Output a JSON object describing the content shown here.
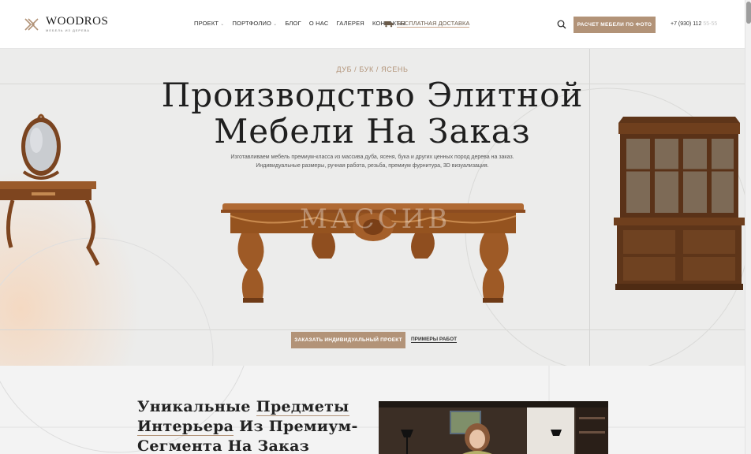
{
  "header": {
    "logo_name": "WOODROS",
    "logo_tagline": "МЕБЕЛЬ ИЗ ДЕРЕВА",
    "nav": [
      {
        "label": "ПРОЕКТ",
        "has_caret": true
      },
      {
        "label": "ПОРТФОЛИО",
        "has_caret": true
      },
      {
        "label": "БЛОГ",
        "has_caret": false
      },
      {
        "label": "О НАС",
        "has_caret": false
      },
      {
        "label": "ГАЛЕРЕЯ",
        "has_caret": false
      },
      {
        "label": "КОНТАКТЫ",
        "has_caret": false
      }
    ],
    "delivery_label": "БЕСПЛАТНАЯ ДОСТАВКА",
    "delivery_icon": "truck-icon",
    "search_icon": "search-icon",
    "cta_label": "РАСЧЕТ МЕБЕЛИ ПО ФОТО",
    "phone_visible": "+7 (930) 112",
    "phone_faded": "55-55"
  },
  "hero": {
    "woods": "ДУБ / БУК / ЯСЕНЬ",
    "title_line1": "Производство Элитной",
    "title_line2": "Мебели На Заказ",
    "subtitle_line1": "Изготавливаем мебель премиум-класса из массива дуба, ясеня, бука и других ценных пород дерева на заказ.",
    "subtitle_line2": "Индивидуальные размеры, ручная работа, резьба, премиум фурнитура, 3D визуализация.",
    "watermark": "МАССИВ",
    "primary_button": "ЗАКАЗАТЬ ИНДИВИДУАЛЬНЫЙ ПРОЕКТ",
    "secondary_link": "ПРИМЕРЫ РАБОТ"
  },
  "lower": {
    "title_line1_a": "Уникальные",
    "title_line1_b": "Предметы",
    "title_line2_a": "Интерьера",
    "title_line2_b": "Из Премиум-",
    "title_line3": "Сегмента На Заказ"
  },
  "colors": {
    "accent": "#b29378",
    "hero_bg": "#ececeb",
    "text_dark": "#1f1f1f"
  }
}
